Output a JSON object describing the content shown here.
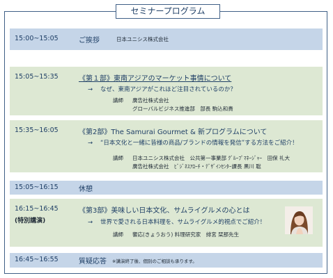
{
  "title": "セミナープログラム",
  "s1": {
    "time": "15:00~15:05",
    "heading": "ご挨拶",
    "org": "日本ユニシス株式会社"
  },
  "s2": {
    "time": "15:05~15:35",
    "heading": "《第１部》東南アジアのマーケット事情について",
    "sub": "なぜ、東南アジアがこれほど注目されているのか？",
    "speaker_label": "講師",
    "speaker_1": "廣告社株式会社",
    "speaker_2": "グローバルビジネス推進部　部長 駒込和貴"
  },
  "s3": {
    "time": "15:35~16:05",
    "heading": "《第2部》The Samurai Gourmet & 新プログラムについて",
    "sub": "“日本文化と一緒に皆様の商品/ブランドの情報を発信”する方法をご紹介！",
    "speaker_label": "講師",
    "speaker_1": "日本ユニシス株式会社　公共第一事業部 ｸﾞﾙｰﾌﾟﾏﾈｰｼﾞｬｰ　田保 礼大",
    "speaker_2": "廣告社株式会社　ﾋﾞｼﾞﾈｽｱﾛｰﾁ・ﾃﾞｻﾞｲﾝｾﾝﾀｰ課長 黒川 聡"
  },
  "s4": {
    "time": "15:05~16:15",
    "heading": "休憩"
  },
  "s5": {
    "time": "16:15~16:45",
    "badge": "(特別講演)",
    "heading": "《第3部》美味しい日本文化、サムライグルメの心とは",
    "sub": "世界で愛される日本料理を、サムライグルメ的視点でご紹介！",
    "speaker_label": "講師",
    "speaker": "饗応(きょうおう) 料理研究家　緋宮 栞那先生"
  },
  "s6": {
    "time": "16:45~16:55",
    "heading": "質疑応答",
    "note": "※講演終了後、個別のご相談も承ります。"
  },
  "arrow": "→"
}
